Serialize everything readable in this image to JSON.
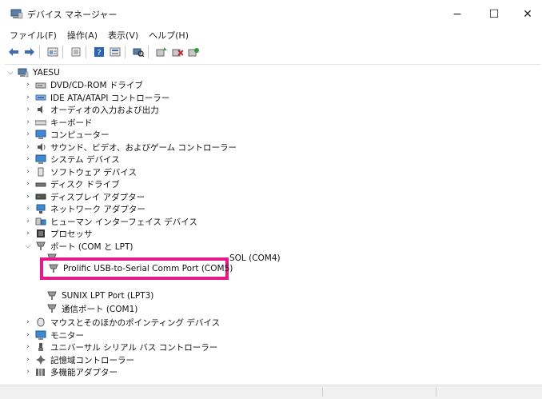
{
  "window": {
    "title": "デバイス マネージャー",
    "minimize": "−",
    "maximize": "☐",
    "close": "✕"
  },
  "menu": {
    "file": "ファイル(F)",
    "action": "操作(A)",
    "view": "表示(V)",
    "help": "ヘルプ(H)"
  },
  "toolbar": {
    "icons": [
      "back-arrow-icon",
      "forward-arrow-icon",
      "properties-icon",
      "update-list-icon",
      "help-icon",
      "device-view-icon",
      "scan-hardware-icon",
      "add-device-icon",
      "uninstall-device-icon",
      "update-driver-icon"
    ]
  },
  "tree": {
    "root": "YAESU",
    "nodes": [
      {
        "label": "DVD/CD-ROM ドライブ",
        "icon": "dvd-drive-icon"
      },
      {
        "label": "IDE ATA/ATAPI コントローラー",
        "icon": "ide-controller-icon"
      },
      {
        "label": "オーディオの入力および出力",
        "icon": "speaker-icon"
      },
      {
        "label": "キーボード",
        "icon": "keyboard-icon"
      },
      {
        "label": "コンピューター",
        "icon": "computer-icon"
      },
      {
        "label": "サウンド、ビデオ、およびゲーム コントローラー",
        "icon": "sound-icon"
      },
      {
        "label": "システム デバイス",
        "icon": "system-device-icon"
      },
      {
        "label": "ソフトウェア デバイス",
        "icon": "software-device-icon"
      },
      {
        "label": "ディスク ドライブ",
        "icon": "disk-drive-icon"
      },
      {
        "label": "ディスプレイ アダプター",
        "icon": "display-adapter-icon"
      },
      {
        "label": "ネットワーク アダプター",
        "icon": "network-adapter-icon"
      },
      {
        "label": "ヒューマン インターフェイス デバイス",
        "icon": "hid-icon"
      },
      {
        "label": "プロセッサ",
        "icon": "processor-icon"
      },
      {
        "label": "ポート (COM と LPT)",
        "icon": "port-icon"
      }
    ],
    "ports": [
      {
        "label": "SOL (COM4)",
        "icon": "port-icon"
      },
      {
        "label": "Prolific USB-to-Serial Comm Port (COM5)",
        "icon": "port-icon"
      },
      {
        "label": "SUNIX LPT Port (LPT3)",
        "icon": "port-icon"
      },
      {
        "label": "通信ポート (COM1)",
        "icon": "port-icon"
      }
    ],
    "after": [
      {
        "label": "マウスとそのほかのポインティング デバイス",
        "icon": "mouse-icon"
      },
      {
        "label": "モニター",
        "icon": "monitor-icon"
      },
      {
        "label": "ユニバーサル シリアル バス コントローラー",
        "icon": "usb-icon"
      },
      {
        "label": "記憶域コントローラー",
        "icon": "storage-controller-icon"
      },
      {
        "label": "多機能アダプター",
        "icon": "multifunction-adapter-icon"
      }
    ]
  },
  "colors": {
    "highlight": "#e6198a",
    "accent": "#1e6fd0"
  }
}
